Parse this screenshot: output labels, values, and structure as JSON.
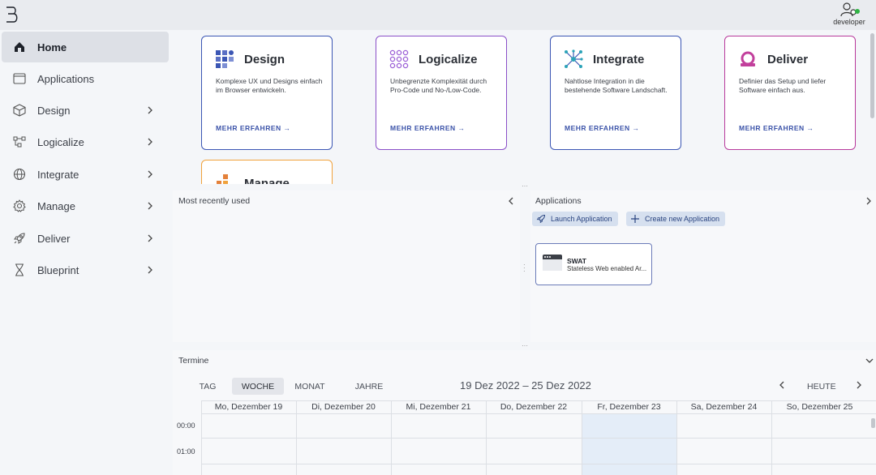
{
  "header": {
    "user_label": "developer",
    "status_color": "#2fb344"
  },
  "sidebar": {
    "items": [
      {
        "label": "Home",
        "icon": "home-icon",
        "active": true
      },
      {
        "label": "Applications",
        "icon": "window-icon"
      },
      {
        "label": "Design",
        "icon": "cube-icon"
      },
      {
        "label": "Logicalize",
        "icon": "flow-icon"
      },
      {
        "label": "Integrate",
        "icon": "globe-icon"
      },
      {
        "label": "Manage",
        "icon": "gear-icon"
      },
      {
        "label": "Deliver",
        "icon": "rocket-icon"
      },
      {
        "label": "Blueprint",
        "icon": "hourglass-icon"
      }
    ]
  },
  "cards": [
    {
      "title": "Design",
      "desc": "Komplexe UX und Designs einfach im Browser entwickeln.",
      "link": "MEHR ERFAHREN →",
      "border": "#3b56b4",
      "icon": "grid-blocks-icon"
    },
    {
      "title": "Logicalize",
      "desc": "Unbegrenzte Komplexität durch Pro-Code und No-/Low-Code.",
      "link": "MEHR ERFAHREN →",
      "border": "#8a4fc8",
      "icon": "dot-grid-icon"
    },
    {
      "title": "Integrate",
      "desc": "Nahtlose Integration in die bestehende Software Landschaft.",
      "link": "MEHR ERFAHREN →",
      "border": "#3b56b4",
      "icon": "network-icon"
    },
    {
      "title": "Deliver",
      "desc": "Definier das Setup und liefer Software einfach aus.",
      "link": "MEHR ERFAHREN →",
      "border": "#b83a9c",
      "icon": "ring-icon"
    },
    {
      "title": "Manage",
      "border": "#f0a23c",
      "icon": "bars-icon"
    }
  ],
  "mru": {
    "title": "Most recently used"
  },
  "applications": {
    "title": "Applications",
    "launch_label": "Launch Application",
    "create_label": "Create new Application",
    "tiles": [
      {
        "name": "SWAT",
        "desc": "Stateless Web enabled Ar..."
      }
    ]
  },
  "calendar": {
    "title": "Termine",
    "views": [
      "TAG",
      "WOCHE",
      "MONAT",
      "JAHRE"
    ],
    "active_view": "WOCHE",
    "range": "19 Dez 2022 – 25 Dez 2022",
    "today_label": "HEUTE",
    "days": [
      "Mo, Dezember 19",
      "Di, Dezember 20",
      "Mi, Dezember 21",
      "Do, Dezember 22",
      "Fr, Dezember 23",
      "Sa, Dezember 24",
      "So, Dezember 25"
    ],
    "highlight_day": "Fr, Dezember 23",
    "hours": [
      "00:00",
      "01:00"
    ]
  }
}
